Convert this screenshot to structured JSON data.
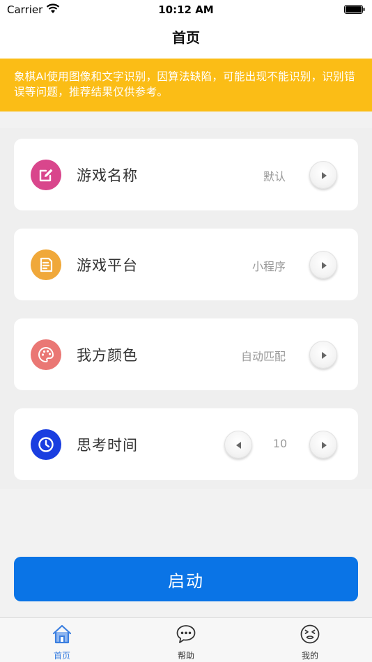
{
  "status_bar": {
    "carrier": "Carrier",
    "time": "10:12 AM"
  },
  "nav": {
    "title": "首页"
  },
  "notice": {
    "text": "象棋AI使用图像和文字识别，因算法缺陷，可能出现不能识别，识别错误等问题，推荐结果仅供参考。"
  },
  "settings": [
    {
      "label": "游戏名称",
      "value": "默认",
      "icon": "edit-icon",
      "color": "#d9468c"
    },
    {
      "label": "游戏平台",
      "value": "小程序",
      "icon": "document-icon",
      "color": "#f0a83a"
    },
    {
      "label": "我方颜色",
      "value": "自动匹配",
      "icon": "palette-icon",
      "color": "#ea7774"
    },
    {
      "label": "思考时间",
      "value": "10",
      "icon": "clock-icon",
      "color": "#1a3ee0"
    }
  ],
  "start_button": {
    "label": "启动"
  },
  "tabs": [
    {
      "label": "首页",
      "icon": "home-icon",
      "active": true
    },
    {
      "label": "帮助",
      "icon": "chat-icon",
      "active": false
    },
    {
      "label": "我的",
      "icon": "face-icon",
      "active": false
    }
  ],
  "colors": {
    "notice_bg": "#fbbd16",
    "primary": "#0a74e6",
    "tab_active": "#3b7fe0"
  }
}
